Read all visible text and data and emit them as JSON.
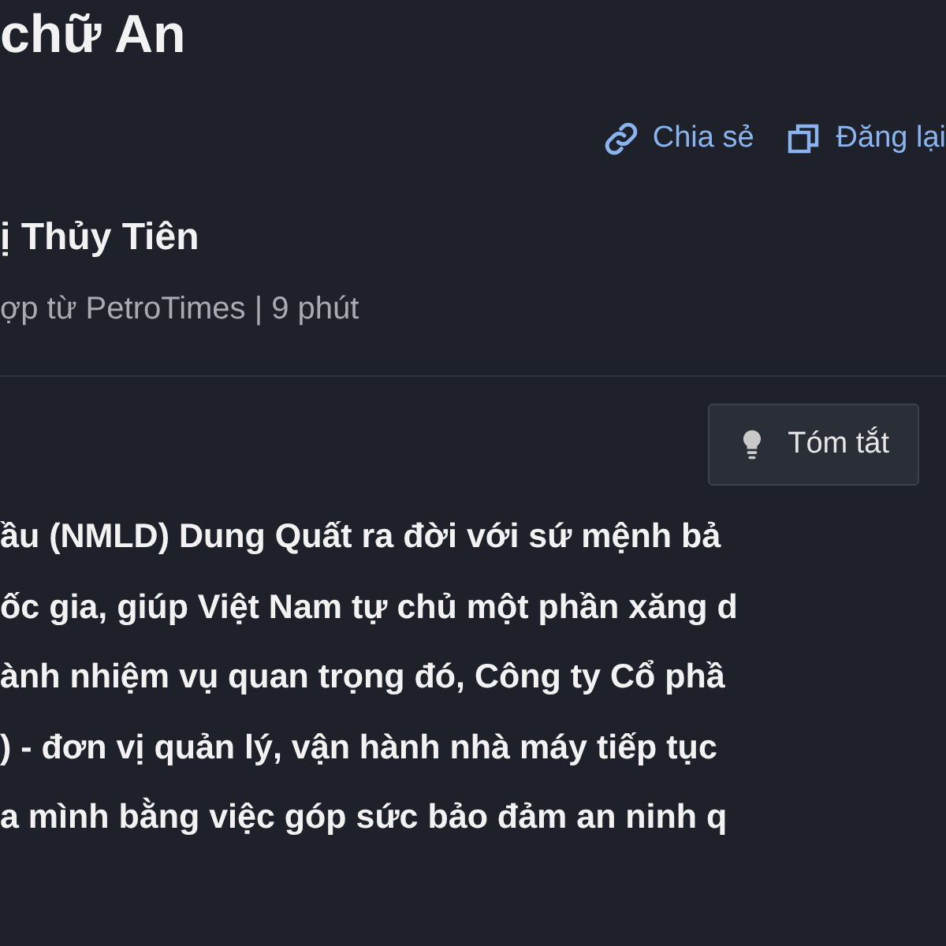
{
  "headline": "chữ An",
  "actions": [
    {
      "kind": "share",
      "label": "Chia sẻ"
    },
    {
      "kind": "repost",
      "label": "Đăng lại"
    }
  ],
  "author": "ị Thủy Tiên",
  "meta": "ợp từ PetroTimes | 9 phút",
  "summary_button": {
    "label": "Tóm tắt"
  },
  "lead_lines": [
    "ầu (NMLD) Dung Quất ra đời với sứ mệnh bả",
    "ốc gia, giúp Việt Nam tự chủ một phần xăng d",
    "ành nhiệm vụ quan trọng đó, Công ty Cổ phầ",
    ") - đơn vị quản lý, vận hành nhà máy tiếp tục",
    "a mình bằng việc góp sức bảo đảm an ninh q"
  ]
}
